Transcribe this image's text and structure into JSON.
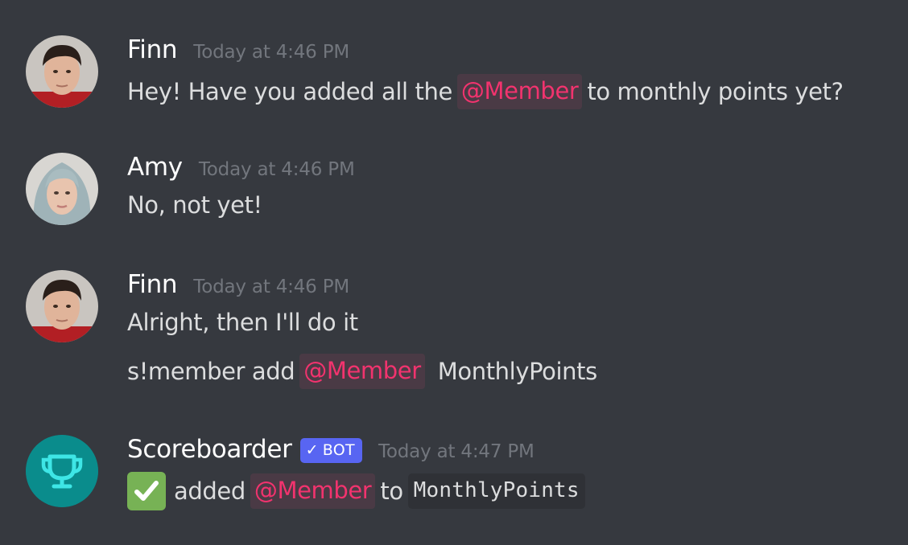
{
  "messages": [
    {
      "username": "Finn",
      "timestamp": "Today at 4:46 PM",
      "avatar": "finn-avatar",
      "lines": [
        {
          "before": "Hey! Have you added all the",
          "mention": "@Member",
          "after": "to monthly points yet?"
        }
      ]
    },
    {
      "username": "Amy",
      "timestamp": "Today at 4:46 PM",
      "avatar": "amy-avatar",
      "lines": [
        {
          "text": "No, not yet!"
        }
      ]
    },
    {
      "username": "Finn",
      "timestamp": "Today at 4:46 PM",
      "avatar": "finn-avatar",
      "lines": [
        {
          "text": "Alright, then I'll do it"
        },
        {
          "before": "s!member add",
          "mention": "@Member",
          "after": "MonthlyPoints"
        }
      ]
    },
    {
      "username": "Scoreboarder",
      "bot_tag": "BOT",
      "bot_check": "✓",
      "timestamp": "Today at 4:47 PM",
      "avatar": "trophy-icon",
      "lines": [
        {
          "emoji": "white-check-mark-icon",
          "before": "added",
          "mention": "@Member",
          "after": "to",
          "code": "MonthlyPoints"
        }
      ]
    }
  ],
  "colors": {
    "background": "#36393f",
    "username": "#ffffff",
    "timestamp": "#72767d",
    "mention_text": "#f2336e",
    "mention_bg": "#4a3a45",
    "bot_tag": "#5865f2",
    "bot_avatar": "#0a8c8c",
    "check_emoji": "#77b255",
    "code_bg": "#2f3136"
  }
}
